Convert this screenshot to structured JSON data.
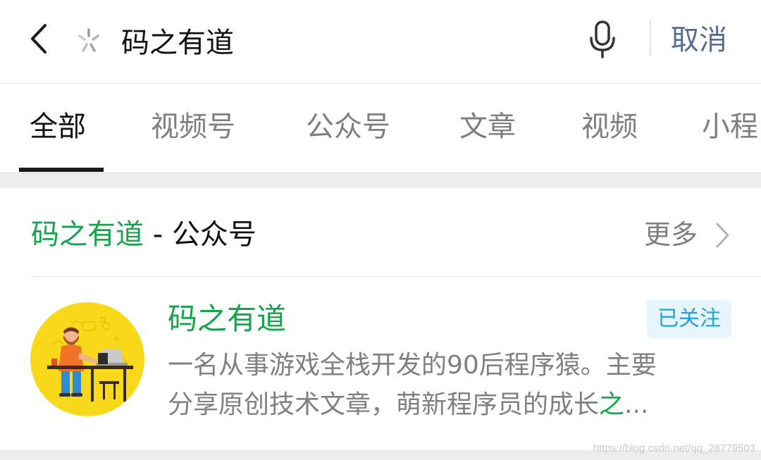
{
  "search": {
    "query": "码之有道",
    "cancel_label": "取消"
  },
  "tabs": [
    {
      "label": "全部",
      "active": true
    },
    {
      "label": "视频号",
      "active": false
    },
    {
      "label": "公众号",
      "active": false
    },
    {
      "label": "文章",
      "active": false
    },
    {
      "label": "视频",
      "active": false
    },
    {
      "label": "小程",
      "active": false
    }
  ],
  "section": {
    "title_highlight": "码之有道",
    "title_suffix": " - 公众号",
    "more_label": "更多"
  },
  "account": {
    "name": "码之有道",
    "follow_status": "已关注",
    "desc_line1": "一名从事游戏全栈开发的90后程序猿。主要",
    "desc_line2_prefix": "分享原创技术文章，萌新程序员的成长",
    "desc_line2_highlight": "之",
    "desc_line2_suffix": "..."
  },
  "watermark": "https://blog.csdn.net/qq_28779503",
  "colors": {
    "accent_green": "#15a44b",
    "link_blue": "#576b95",
    "badge_blue": "#1aa6d8",
    "badge_bg": "#e8f4fb"
  },
  "icons": {
    "back": "chevron-left-icon",
    "loading": "loading-icon",
    "mic": "microphone-icon",
    "more": "chevron-right-icon"
  }
}
